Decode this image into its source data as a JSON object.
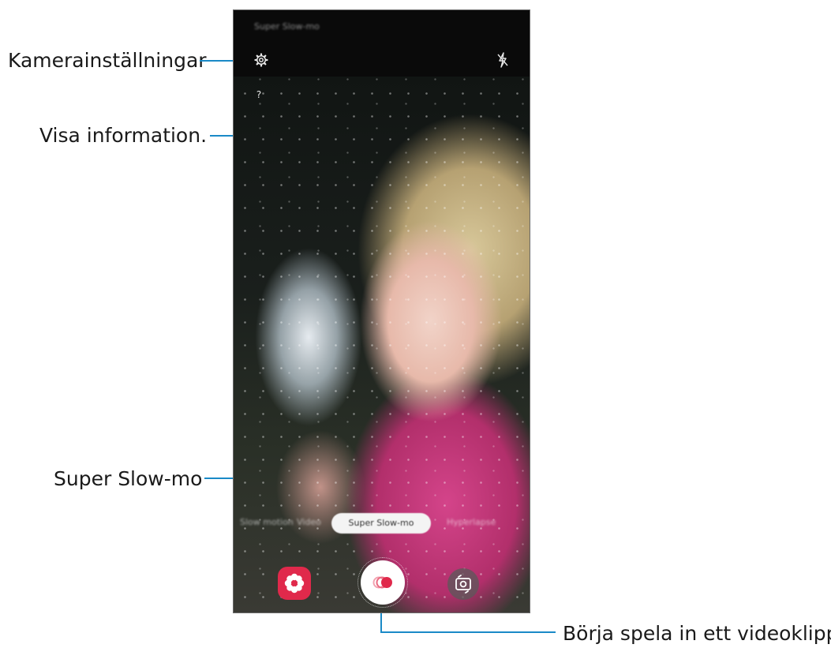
{
  "callouts": {
    "camera_settings": "Kamerainställningar",
    "show_information": "Visa information.",
    "super_slow_mo": "Super Slow-mo",
    "start_recording": "Börja spela in ett videoklipp."
  },
  "screen": {
    "mode_title": "Super Slow-mo",
    "info_glyph": "?",
    "modes": [
      "Slow motion",
      "Video",
      "Super Slow-mo",
      "Hyperlapse"
    ],
    "selected_mode": "Super Slow-mo"
  },
  "colors": {
    "leader_line": "#1a8ac7",
    "effects_button": "#e0294b",
    "record_dot": "#e0294b"
  },
  "icons": {
    "settings": "gear-icon",
    "flash": "flash-off-icon",
    "info": "info-icon",
    "effects": "flower-icon",
    "record": "record-icon",
    "switch_camera": "switch-camera-icon"
  }
}
